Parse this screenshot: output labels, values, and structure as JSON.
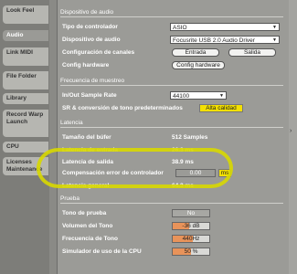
{
  "sidebar": {
    "tabs": [
      {
        "label": "Look Feel"
      },
      {
        "label": "Audio"
      },
      {
        "label": "Link MIDI"
      },
      {
        "label": "File Folder"
      },
      {
        "label": "Library"
      },
      {
        "label": "Record Warp Launch"
      },
      {
        "label": "CPU"
      },
      {
        "label": "Licenses Maintenance"
      }
    ]
  },
  "audio_device": {
    "section_title": "Dispositivo de audio",
    "driver_label": "Tipo de controlador",
    "driver_value": "ASIO",
    "device_label": "Dispositivo de audio",
    "device_value": "Focusrite USB 2.0 Audio Driver",
    "channels_label": "Configuración de canales",
    "input_button": "Entrada",
    "output_button": "Salida",
    "hw_label": "Config hardware",
    "hw_button": "Config hardware"
  },
  "sample_rate": {
    "section_title": "Frecuencia de muestreo",
    "rate_label": "In/Out Sample Rate",
    "rate_value": "44100",
    "sr_label": "SR & conversión de tono predeterminados",
    "sr_button": "Alta calidad"
  },
  "latency": {
    "section_title": "Latencia",
    "buffer_label": "Tamaño del búfer",
    "buffer_value": "512 Samples",
    "input_label": "Latencia de entrada",
    "input_value": "26.3 ms",
    "output_label": "Latencia de salida",
    "output_value": "38.9 ms",
    "comp_label": "Compensación error de controlador",
    "comp_value": "0.00",
    "comp_unit": "ms",
    "overall_label": "Latencia general",
    "overall_value": "64.3 ms"
  },
  "test": {
    "section_title": "Prueba",
    "tone_label": "Tono de prueba",
    "tone_value": "No",
    "volume_label": "Volumen del Tono",
    "volume_value": "-36",
    "volume_unit": "dB",
    "volume_fill": 0.45,
    "freq_label": "Frecuencia de Tono",
    "freq_value": "440",
    "freq_unit": "Hz",
    "freq_fill": 0.55,
    "cpu_label": "Simulador de uso de la CPU",
    "cpu_value": "50",
    "cpu_unit": "%",
    "cpu_fill": 0.5
  },
  "colors": {
    "highlight": "#d8d800",
    "accent_yellow": "#f4e000",
    "slider_fill": "#e8935a"
  }
}
